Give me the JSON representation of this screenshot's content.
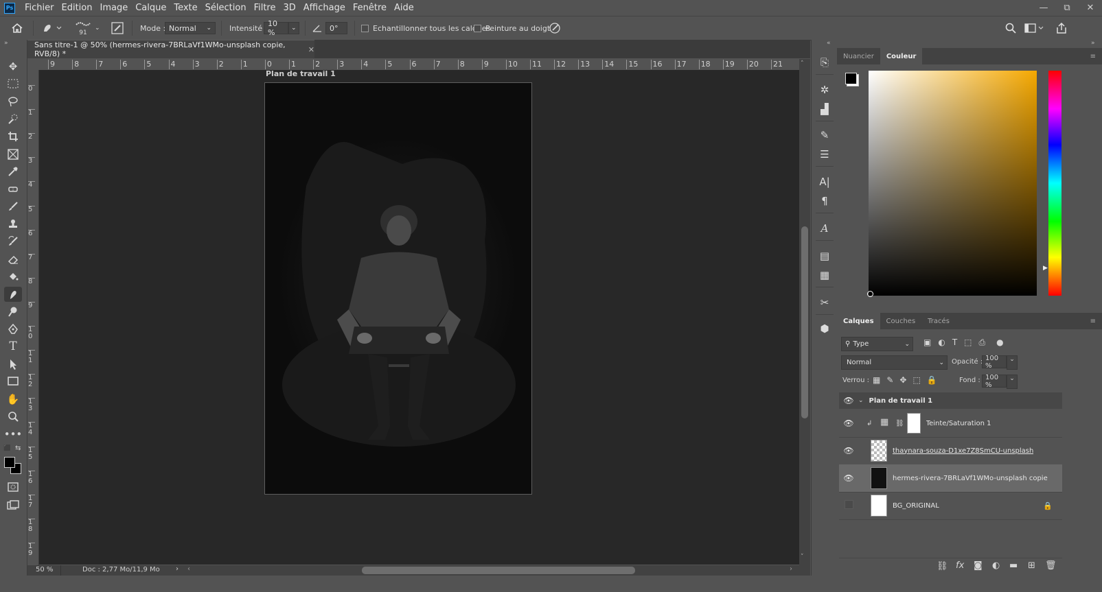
{
  "app": {
    "logo": "Ps"
  },
  "menu": [
    "Fichier",
    "Edition",
    "Image",
    "Calque",
    "Texte",
    "Sélection",
    "Filtre",
    "3D",
    "Affichage",
    "Fenêtre",
    "Aide"
  ],
  "window_controls": {
    "minimize": "—",
    "restore": "⧉",
    "close": "✕"
  },
  "options_bar": {
    "brush_size": "91",
    "mode_label": "Mode :",
    "mode_value": "Normal",
    "intensity_label": "Intensité :",
    "intensity_value": "10 %",
    "angle_value": "0°",
    "sample_all_layers": "Echantillonner tous les calques",
    "finger_painting": "Peinture au doigt"
  },
  "document": {
    "tab_title": "Sans titre-1 @ 50% (hermes-rivera-7BRLaVf1WMo-unsplash copie, RVB/8) *",
    "artboard_title": "Plan de travail 1",
    "zoom": "50 %",
    "doc_info": "Doc : 2,77 Mo/11,9 Mo"
  },
  "rulers": {
    "horizontal": [
      "9",
      "8",
      "7",
      "6",
      "5",
      "4",
      "3",
      "2",
      "1",
      "0",
      "1",
      "2",
      "3",
      "4",
      "5",
      "6",
      "7",
      "8",
      "9",
      "10",
      "11",
      "12",
      "13",
      "14",
      "15",
      "16",
      "17",
      "18",
      "19",
      "20",
      "21"
    ],
    "vertical": [
      "0",
      "1",
      "2",
      "3",
      "4",
      "5",
      "6",
      "7",
      "8",
      "9",
      "10",
      "11",
      "12",
      "13",
      "14",
      "15",
      "16",
      "17",
      "18",
      "19"
    ]
  },
  "color_panel": {
    "tabs": [
      "Nuancier",
      "Couleur"
    ],
    "active_tab": "Couleur",
    "foreground": "#000000",
    "background": "#ffffff",
    "hue_color": "#f5a800"
  },
  "layers_panel": {
    "tabs": [
      "Calques",
      "Couches",
      "Tracés"
    ],
    "active_tab": "Calques",
    "filter_value": "Type",
    "blend_mode": "Normal",
    "opacity_label": "Opacité :",
    "opacity_value": "100 %",
    "lock_label": "Verrou :",
    "fill_label": "Fond :",
    "fill_value": "100 %",
    "group_name": "Plan de travail 1",
    "layers": [
      {
        "name": "Teinte/Saturation 1",
        "visible": true,
        "selected": false
      },
      {
        "name": "thaynara-souza-D1xe7Z8SmCU-unsplash",
        "visible": true,
        "selected": false
      },
      {
        "name": "hermes-rivera-7BRLaVf1WMo-unsplash copie",
        "visible": true,
        "selected": true
      },
      {
        "name": "BG_ORIGINAL",
        "visible": false,
        "selected": false,
        "locked": true
      }
    ]
  }
}
